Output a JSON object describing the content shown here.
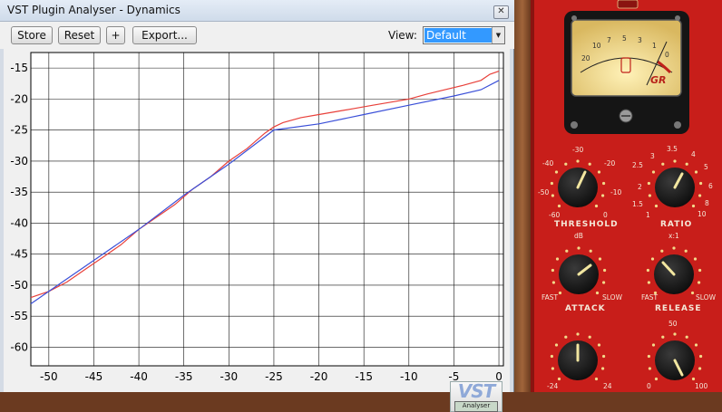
{
  "window": {
    "title": "VST Plugin Analyser - Dynamics",
    "close_glyph": "✕"
  },
  "toolbar": {
    "store_label": "Store",
    "reset_label": "Reset",
    "plus_label": "+",
    "export_label": "Export...",
    "view_label": "View:",
    "view_value": "Default",
    "dropdown_glyph": "▼"
  },
  "logo": {
    "text": "VST",
    "subtext": "Analyser"
  },
  "chart_data": {
    "type": "line",
    "xlim": [
      -52,
      0.5
    ],
    "ylim": [
      -63,
      -12.5
    ],
    "xticks": [
      -50,
      -45,
      -40,
      -35,
      -30,
      -25,
      -20,
      -15,
      -10,
      -5,
      0
    ],
    "yticks": [
      -15,
      -20,
      -25,
      -30,
      -35,
      -40,
      -45,
      -50,
      -55,
      -60
    ],
    "grid": true,
    "series": [
      {
        "color": "#e8403a",
        "x": [
          -52,
          -50,
          -48,
          -46,
          -44,
          -42,
          -40,
          -38,
          -36,
          -34,
          -32,
          -30,
          -28,
          -26,
          -25,
          -24,
          -22,
          -20,
          -18,
          -16,
          -14,
          -12,
          -10,
          -8,
          -6,
          -4,
          -2,
          -1,
          0
        ],
        "y": [
          -52,
          -51,
          -49.5,
          -47.5,
          -45.5,
          -43.5,
          -41,
          -39,
          -37,
          -34.5,
          -32.5,
          -30,
          -28,
          -25.5,
          -24.5,
          -23.8,
          -23,
          -22.5,
          -22,
          -21.5,
          -21,
          -20.5,
          -20,
          -19.2,
          -18.5,
          -17.8,
          -17,
          -16,
          -15.5
        ]
      },
      {
        "color": "#3a4fd8",
        "x": [
          -52,
          -50,
          -45,
          -40,
          -35,
          -30,
          -25,
          -20,
          -15,
          -10,
          -5,
          -2,
          0
        ],
        "y": [
          -53,
          -51,
          -46,
          -41,
          -35.5,
          -30.5,
          -25,
          -24,
          -22.5,
          -21,
          -19.5,
          -18.5,
          -17
        ]
      }
    ]
  },
  "compressor": {
    "meter_label": "GR",
    "meter_scale": [
      "20",
      "10",
      "7",
      "5",
      "3",
      "1",
      "0"
    ],
    "threshold": {
      "title": "THRESHOLD",
      "unit": "dB",
      "scale": [
        "-60",
        "-50",
        "-40",
        "-30",
        "-20",
        "-10",
        "0"
      ]
    },
    "ratio": {
      "title": "RATIO",
      "unit": "x:1",
      "scale": [
        "1",
        "1.5",
        "2",
        "2.5",
        "3",
        "3.5",
        "4",
        "5",
        "6",
        "8",
        "10"
      ]
    },
    "attack": {
      "title": "ATTACK",
      "min": "FAST",
      "max": "SLOW"
    },
    "release": {
      "title": "RELEASE",
      "min": "FAST",
      "max": "SLOW"
    },
    "gain_left": {
      "min": "-24",
      "max": "24"
    },
    "gain_right": {
      "min": "0",
      "mid": "50",
      "max": "100"
    },
    "colors": {
      "panel": "#c81e1a",
      "knob": "#141414",
      "meter_face": "#f2d98a"
    }
  }
}
